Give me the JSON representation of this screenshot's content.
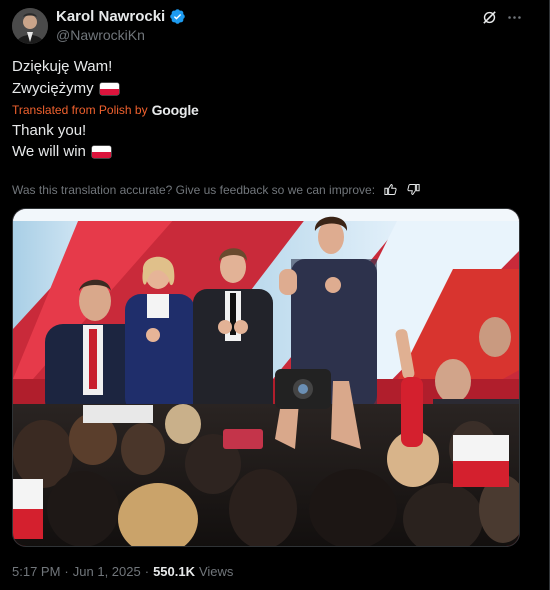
{
  "author": {
    "name": "Karol Nawrocki",
    "handle": "@NawrockiKn",
    "verified": true,
    "avatar_icon": "profile-photo"
  },
  "tweet": {
    "original_lines": [
      "Dziękuję Wam!",
      "Zwyciężymy"
    ],
    "translated_from": "Translated from Polish by",
    "translation_provider": "Google",
    "translated_lines": [
      "Thank you!",
      "We will win"
    ],
    "flag_icon": "poland-flag-icon"
  },
  "feedback": {
    "question": "Was this translation accurate? Give us feedback so we can improve:"
  },
  "media": {
    "image_icon": "photo-victory-stage"
  },
  "meta": {
    "time": "5:17 PM",
    "separator": "·",
    "date": "Jun 1, 2025",
    "views_count": "550.1K",
    "views_label": "Views"
  },
  "colors": {
    "background": "#000000",
    "text": "#e7e9ea",
    "muted": "#71767b",
    "verified": "#1d9bf0",
    "translated": "#f0612e",
    "flag_red": "#dc143c"
  }
}
